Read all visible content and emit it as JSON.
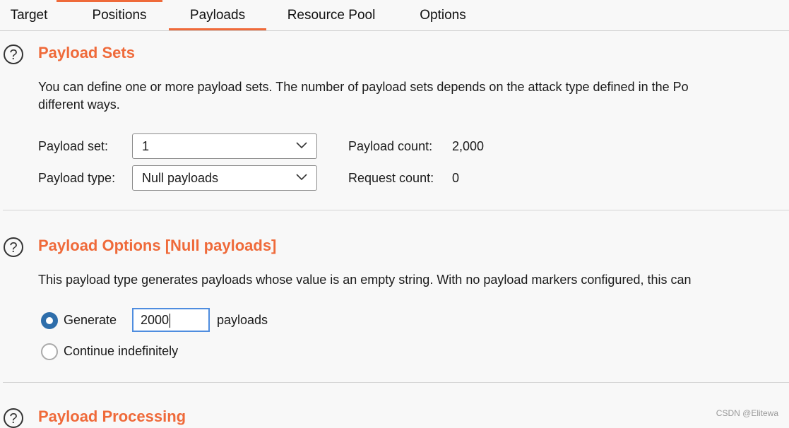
{
  "tabs": [
    {
      "label": "Target"
    },
    {
      "label": "Positions"
    },
    {
      "label": "Payloads"
    },
    {
      "label": "Resource Pool"
    },
    {
      "label": "Options"
    }
  ],
  "accent_color": "#ef6a3a",
  "payload_sets": {
    "title": "Payload Sets",
    "description_line1": "You can define one or more payload sets. The number of payload sets depends on the attack type defined in the Po",
    "description_line2": "different ways.",
    "payload_set_label": "Payload set:",
    "payload_set_value": "1",
    "payload_type_label": "Payload type:",
    "payload_type_value": "Null payloads",
    "payload_count_label": "Payload count:",
    "payload_count_value": "2,000",
    "request_count_label": "Request count:",
    "request_count_value": "0"
  },
  "payload_options": {
    "title": "Payload Options [Null payloads]",
    "description": "This payload type generates payloads whose value is an empty string. With no payload markers configured, this can",
    "generate_label": "Generate",
    "generate_value": "2000",
    "payloads_suffix": "payloads",
    "continue_label": "Continue indefinitely"
  },
  "payload_processing": {
    "title": "Payload Processing"
  },
  "help_glyph": "?",
  "watermark": "CSDN @Elitewa"
}
